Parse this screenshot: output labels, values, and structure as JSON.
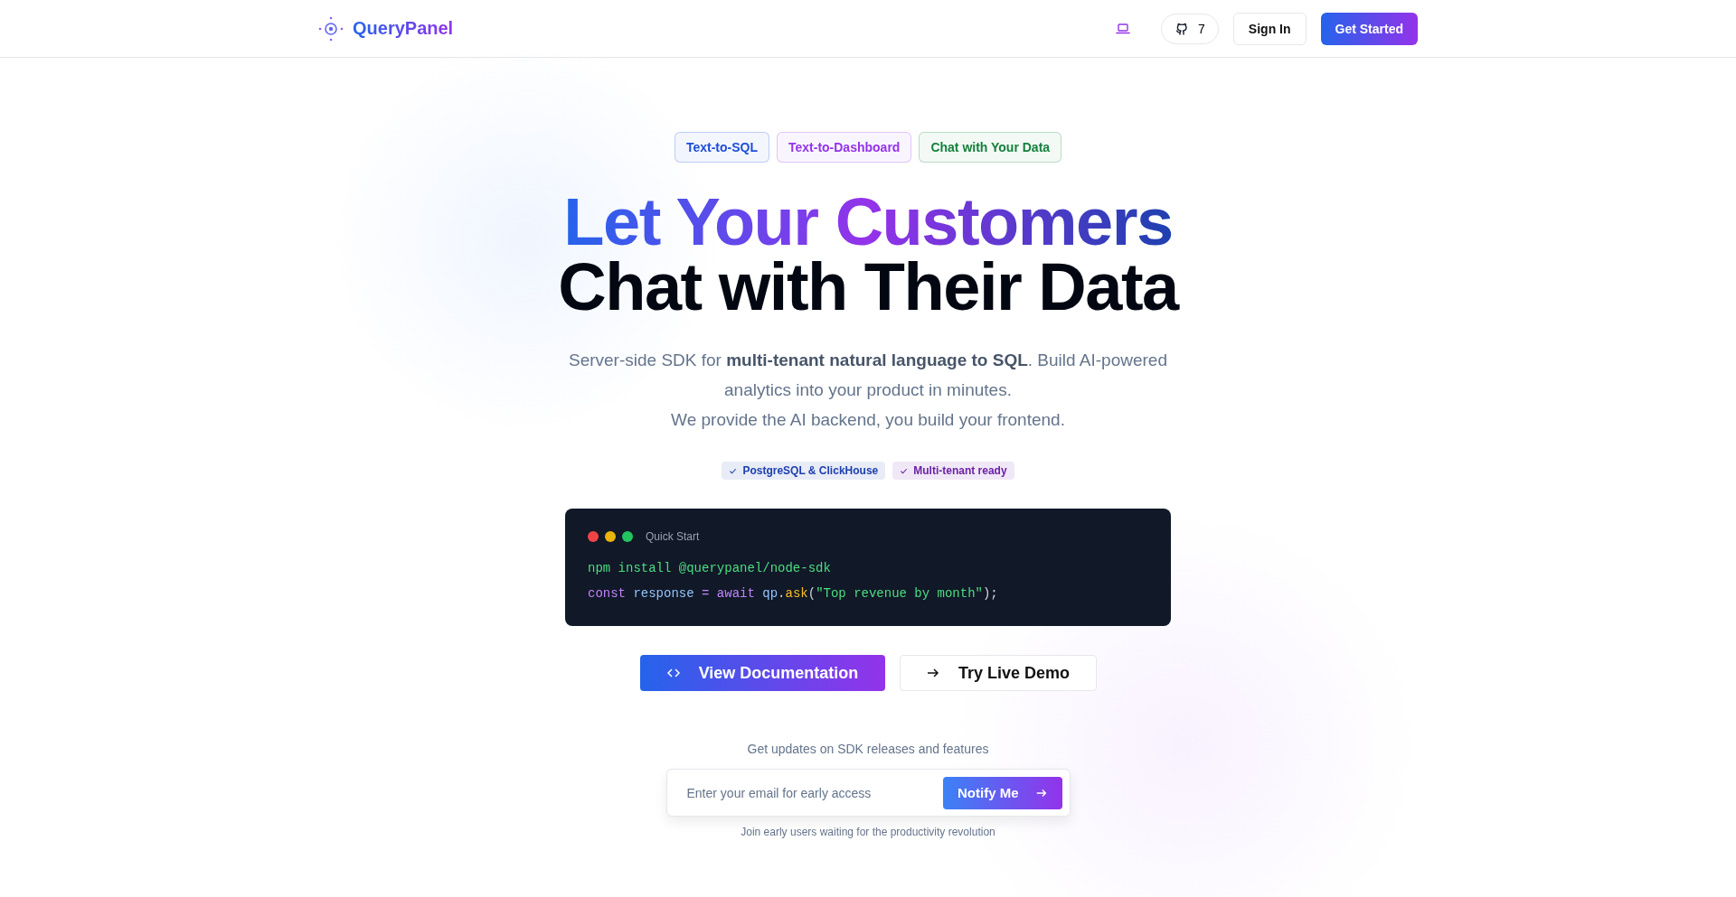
{
  "nav": {
    "brand": "QueryPanel",
    "github_stars": "7",
    "sign_in": "Sign In",
    "get_started": "Get Started"
  },
  "tags": [
    {
      "label": "Text-to-SQL",
      "color": "#1d4ed8"
    },
    {
      "label": "Text-to-Dashboard",
      "color": "#9333ea"
    },
    {
      "label": "Chat with Your Data",
      "color": "#15803d"
    }
  ],
  "headline": {
    "line_1": "Let Your Customers",
    "line_2": "Chat with Their Data"
  },
  "subtitle": [
    "Server-side SDK for **multi-tenant natural language to SQL**. Build AI-powered analytics into your product in minutes.",
    "We provide the AI backend, you build your frontend."
  ],
  "features": [
    {
      "label": "PostgreSQL & ClickHouse",
      "color": "#1e40af"
    },
    {
      "label": "Multi-tenant ready",
      "color": "#6b21a8"
    }
  ],
  "code": {
    "title": "Quick Start",
    "lines": [
      [
        {
          "kind": "string",
          "text": "npm install @querypanel/node-sdk"
        }
      ],
      [
        {
          "kind": "keyword",
          "text": "const"
        },
        {
          "kind": "plain",
          "text": " response"
        },
        {
          "kind": "operator",
          "text": " = "
        },
        {
          "kind": "keyword",
          "text": "await"
        },
        {
          "kind": "plain",
          "text": " qp"
        },
        {
          "kind": "punct",
          "text": "."
        },
        {
          "kind": "function",
          "text": "ask"
        },
        {
          "kind": "punct",
          "text": "("
        },
        {
          "kind": "string",
          "text": "\"Top revenue by month\""
        },
        {
          "kind": "punct",
          "text": ");"
        }
      ]
    ]
  },
  "actions": {
    "primary": "View Documentation",
    "secondary": "Try Live Demo"
  },
  "signup": {
    "heading": "Get updates on SDK releases and features",
    "placeholder": "Enter your email for early access",
    "button": "Notify Me",
    "note": "Join early users waiting for the productivity revolution"
  }
}
